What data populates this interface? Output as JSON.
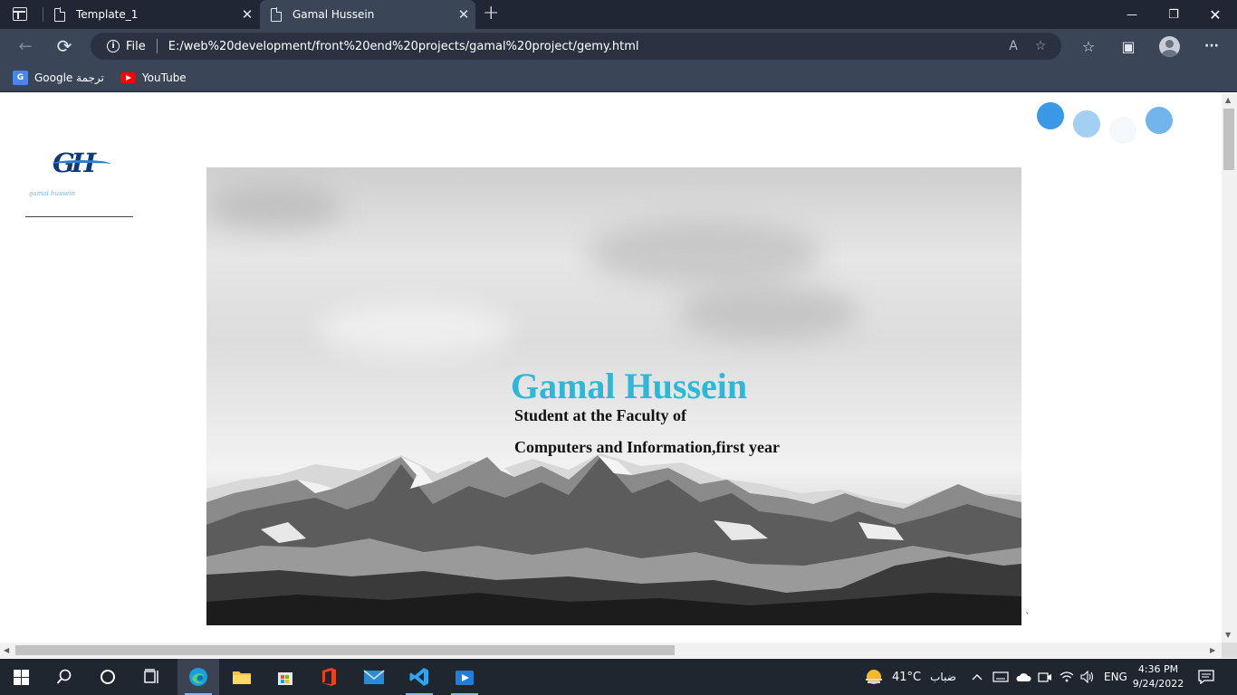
{
  "browser": {
    "tabs": [
      {
        "title": "Template_1",
        "active": false
      },
      {
        "title": "Gamal Hussein",
        "active": true
      }
    ],
    "address": {
      "scheme_label": "File",
      "url": "E:/web%20development/front%20end%20projects/gamal%20project/gemy.html"
    },
    "favorites": [
      {
        "label": "Google ترجمة",
        "icon": "google-translate-icon"
      },
      {
        "label": "YouTube",
        "icon": "youtube-icon"
      }
    ],
    "new_tab_symbol": "+",
    "icons": {
      "back": "←",
      "refresh": "⟳",
      "read_aloud": "A",
      "add_favorite": "☆",
      "favorites": "☆",
      "collections": "▣",
      "more": "···",
      "close": "✕",
      "minimize": "—",
      "restore": "❐"
    }
  },
  "page": {
    "logo": {
      "mark": "GH",
      "subtitle": "gamal hussein"
    },
    "hero": {
      "title": "Gamal Hussein",
      "subtitle_line1": "Student at the Faculty of",
      "subtitle_line2": "Computers and Information,first year"
    },
    "stray_char": "`",
    "dot_colors": [
      "#3a98e6",
      "#a3cff3",
      "#f4f9fd",
      "#72b4ec"
    ]
  },
  "taskbar": {
    "weather": {
      "temp": "41°C",
      "condition": "ضباب"
    },
    "language": "ENG",
    "clock": {
      "time": "4:36 PM",
      "date": "9/24/2022"
    }
  },
  "colors": {
    "tabbar": "#202634",
    "toolbar": "#3a4558",
    "hero_title": "#2fb7d8",
    "taskbar": "#202630"
  }
}
